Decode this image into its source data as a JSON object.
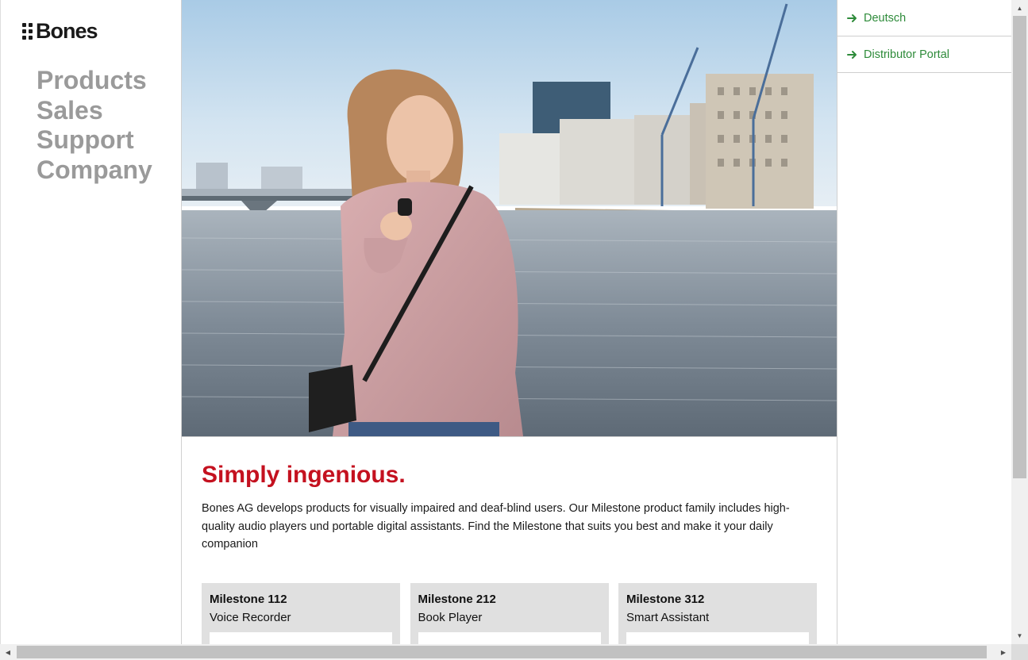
{
  "brand": {
    "logo_text": "Bones"
  },
  "nav": {
    "items": [
      {
        "label": "Products"
      },
      {
        "label": "Sales"
      },
      {
        "label": "Support"
      },
      {
        "label": "Company"
      }
    ]
  },
  "hero": {
    "image": "woman-with-voice-recorder-by-river-photo"
  },
  "main": {
    "headline": "Simply ingenious.",
    "intro": "Bones AG develops products for visually impaired and deaf-blind users. Our Milestone product family includes high-quality audio players und portable digital assistants. Find the Milestone that suits you best and make it your daily companion",
    "products": [
      {
        "name": "Milestone 112",
        "description": "Voice Recorder"
      },
      {
        "name": "Milestone 212",
        "description": "Book Player"
      },
      {
        "name": "Milestone 312",
        "description": "Smart Assistant"
      }
    ]
  },
  "rightbar": {
    "links": [
      {
        "label": "Deutsch",
        "icon": "arrow-right-icon"
      },
      {
        "label": "Distributor Portal",
        "icon": "arrow-right-icon"
      }
    ]
  },
  "colors": {
    "accent_red": "#c4111f",
    "link_green": "#2e8b3a",
    "nav_gray": "#9a9a9a",
    "card_bg": "#e0e0e0"
  }
}
